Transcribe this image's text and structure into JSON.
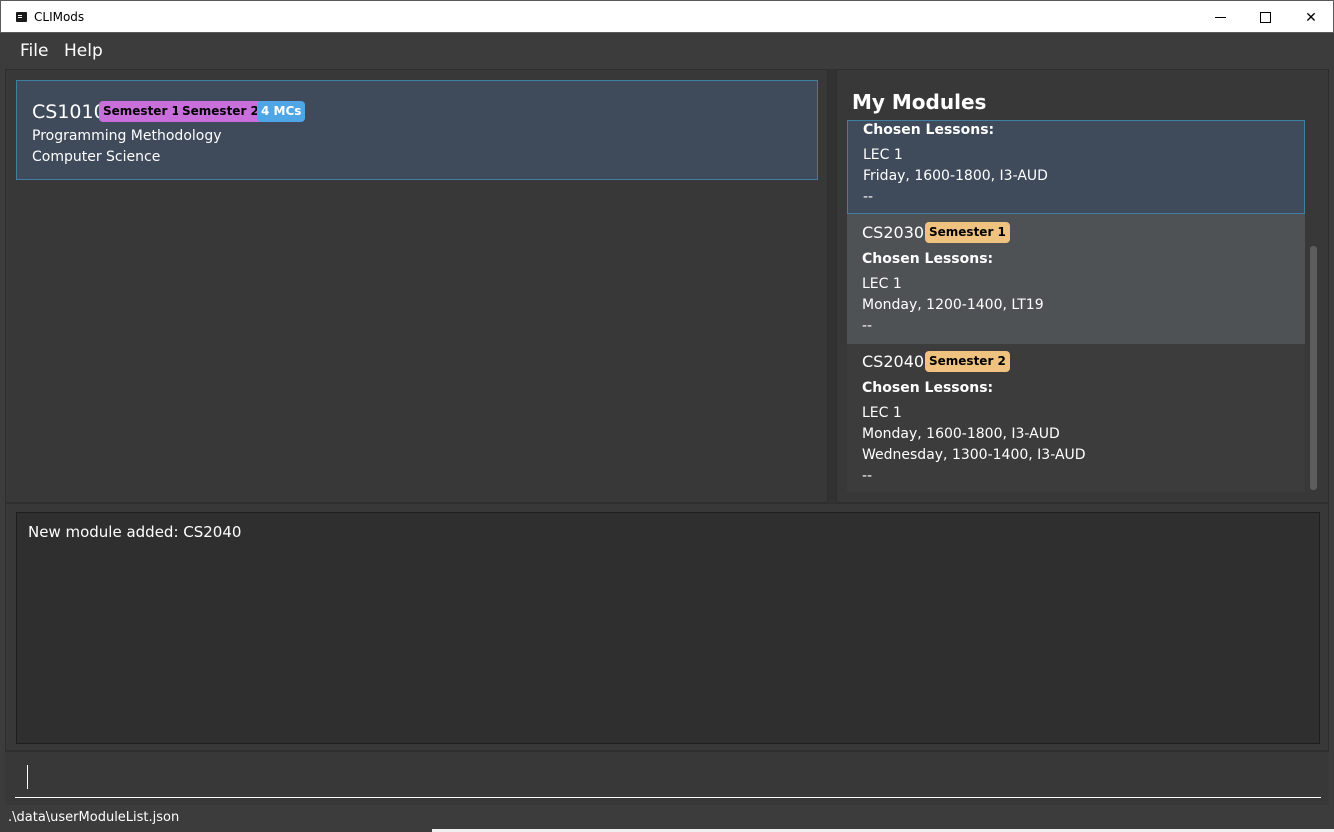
{
  "window": {
    "title": "CLIMods",
    "minimize_icon": "minimize-icon",
    "maximize_icon": "maximize-icon",
    "close_label": "✕"
  },
  "menu": {
    "file": "File",
    "help": "Help"
  },
  "module_list": {
    "items": [
      {
        "code": "CS1010",
        "tags": [
          "Semester 1",
          "Semester 2"
        ],
        "credits": "4 MCs",
        "title": "Programming Methodology",
        "department": "Computer Science"
      }
    ]
  },
  "my_modules": {
    "heading": "My Modules",
    "items": [
      {
        "chosen_label": "Chosen Lessons:",
        "lines": [
          "LEC 1",
          "Friday, 1600-1800, I3-AUD",
          "--"
        ]
      },
      {
        "code": "CS2030",
        "tag": "Semester 1",
        "chosen_label": "Chosen Lessons:",
        "lines": [
          "LEC 1",
          "Monday, 1200-1400, LT19",
          "--"
        ]
      },
      {
        "code": "CS2040",
        "tag": "Semester 2",
        "chosen_label": "Chosen Lessons:",
        "lines": [
          "LEC 1",
          "Monday, 1600-1800, I3-AUD",
          "Wednesday, 1300-1400, I3-AUD",
          "--"
        ]
      }
    ]
  },
  "result": {
    "message": "New module added: CS2040"
  },
  "command": {
    "value": ""
  },
  "status": {
    "path": ".\\data\\userModuleList.json"
  },
  "colors": {
    "background": "#3c3c3c",
    "selected_card": "#3f4a5b",
    "selected_border": "#3e7fa2",
    "tag_semester_purple": "#c86fdc",
    "tag_mc_blue": "#4fa6e6",
    "tag_semester_orange": "#f0c27f"
  }
}
